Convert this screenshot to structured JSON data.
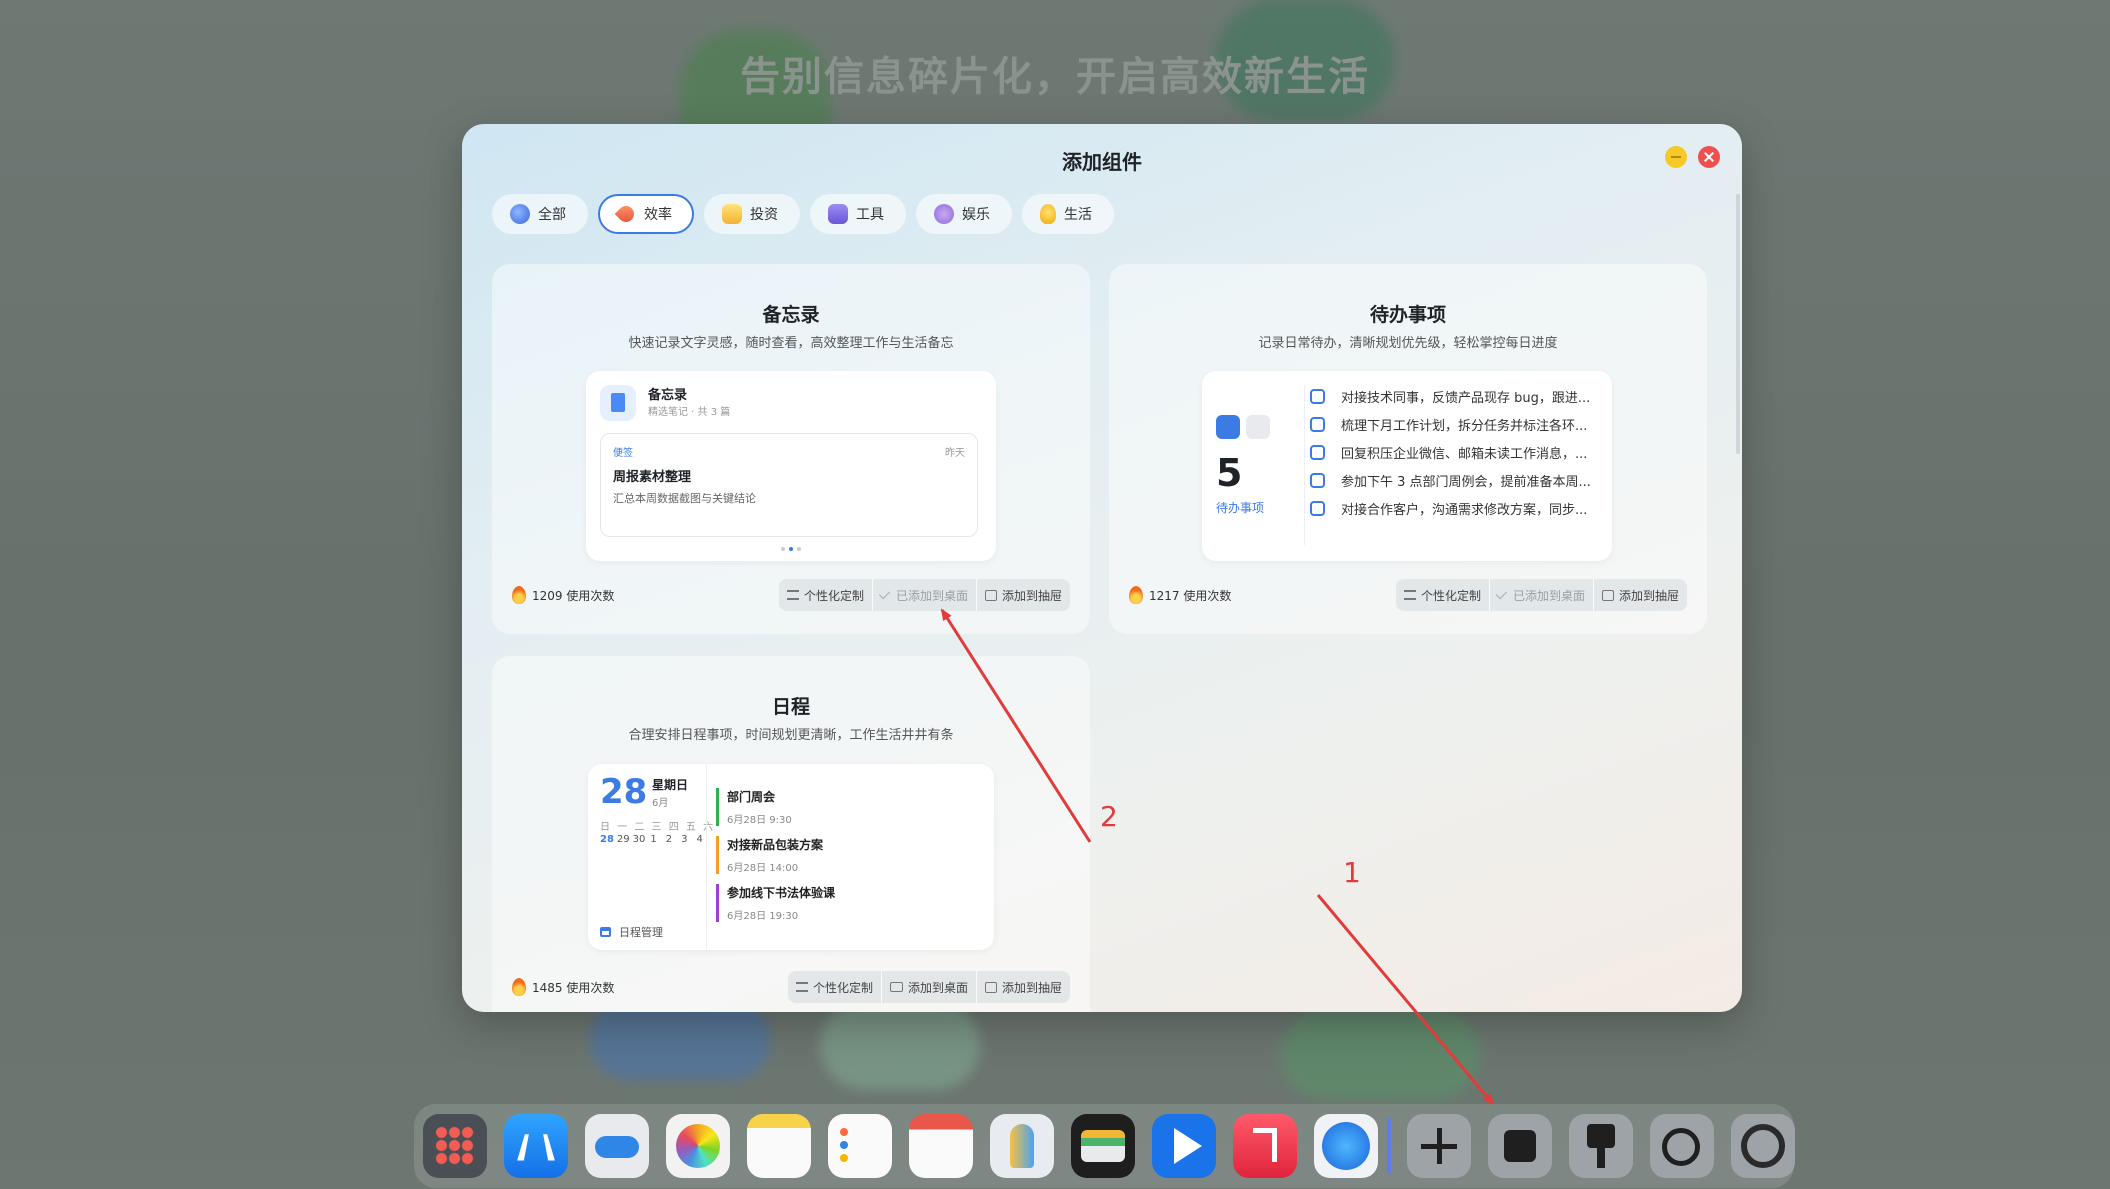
{
  "background": {
    "headline": "告别信息碎片化，开启高效新生活"
  },
  "modal": {
    "title": "添加组件",
    "tabs": [
      {
        "label": "全部",
        "icon": "globe-icon",
        "active": false
      },
      {
        "label": "效率",
        "icon": "rocket-icon",
        "active": true
      },
      {
        "label": "投资",
        "icon": "chart-icon",
        "active": false
      },
      {
        "label": "工具",
        "icon": "toolbox-icon",
        "active": false
      },
      {
        "label": "娱乐",
        "icon": "gamepad-icon",
        "active": false
      },
      {
        "label": "生活",
        "icon": "bulb-icon",
        "active": false
      }
    ],
    "widgets": {
      "memo": {
        "title": "备忘录",
        "desc": "快速记录文字灵感，随时查看，高效整理工作与生活备忘",
        "preview": {
          "app_name": "备忘录",
          "sub": "精选笔记 · 共 3 篇",
          "tag": "便签",
          "date": "昨天",
          "note_title": "周报素材整理",
          "note_body": "汇总本周数据截图与关键结论"
        },
        "usage": "1209 使用次数",
        "actions": {
          "customize": "个性化定制",
          "added_desktop": "已添加到桌面",
          "add_drawer": "添加到抽屉"
        }
      },
      "todo": {
        "title": "待办事项",
        "desc": "记录日常待办，清晰规划优先级，轻松掌控每日进度",
        "preview": {
          "count": "5",
          "label": "待办事项",
          "items": [
            "对接技术同事，反馈产品现存 bug，跟进...",
            "梳理下月工作计划，拆分任务并标注各环...",
            "回复积压企业微信、邮箱未读工作消息，...",
            "参加下午 3 点部门周例会，提前准备本周...",
            "对接合作客户，沟通需求修改方案，同步..."
          ]
        },
        "usage": "1217 使用次数",
        "actions": {
          "customize": "个性化定制",
          "added_desktop": "已添加到桌面",
          "add_drawer": "添加到抽屉"
        }
      },
      "schedule": {
        "title": "日程",
        "desc": "合理安排日程事项，时间规划更清晰，工作生活井井有条",
        "preview": {
          "day": "28",
          "weekday": "星期日",
          "month": "6月",
          "week_header": "日 一 二 三 四 五 六",
          "week_days": [
            "28",
            "29",
            "30",
            "1",
            "2",
            "3",
            "4"
          ],
          "footer": "日程管理",
          "events": [
            {
              "title": "部门周会",
              "time": "6月28日 9:30",
              "color": "#2bb24c"
            },
            {
              "title": "对接新品包装方案",
              "time": "6月28日 14:00",
              "color": "#f0a020"
            },
            {
              "title": "参加线下书法体验课",
              "time": "6月28日 19:30",
              "color": "#a040d0"
            }
          ]
        },
        "usage": "1485 使用次数",
        "actions": {
          "customize": "个性化定制",
          "add_desktop": "添加到桌面",
          "add_drawer": "添加到抽屉"
        }
      }
    }
  },
  "annotations": {
    "one": "1",
    "two": "2",
    "color": "#e23b3b"
  },
  "dock": {
    "apps": [
      "launchpad-icon",
      "app-store-icon",
      "icloud-icon",
      "photos-icon",
      "notes-icon",
      "reminders-icon",
      "calendar-icon",
      "keychain-icon",
      "wallet-icon",
      "video-player-icon",
      "music-icon",
      "safari-icon",
      "add-icon",
      "widgets-puzzle-icon",
      "brush-icon",
      "security-icon",
      "settings-icon"
    ]
  },
  "colors": {
    "accent": "#3c7be6",
    "close": "#ef4f4f",
    "minimize": "#f6c828"
  }
}
